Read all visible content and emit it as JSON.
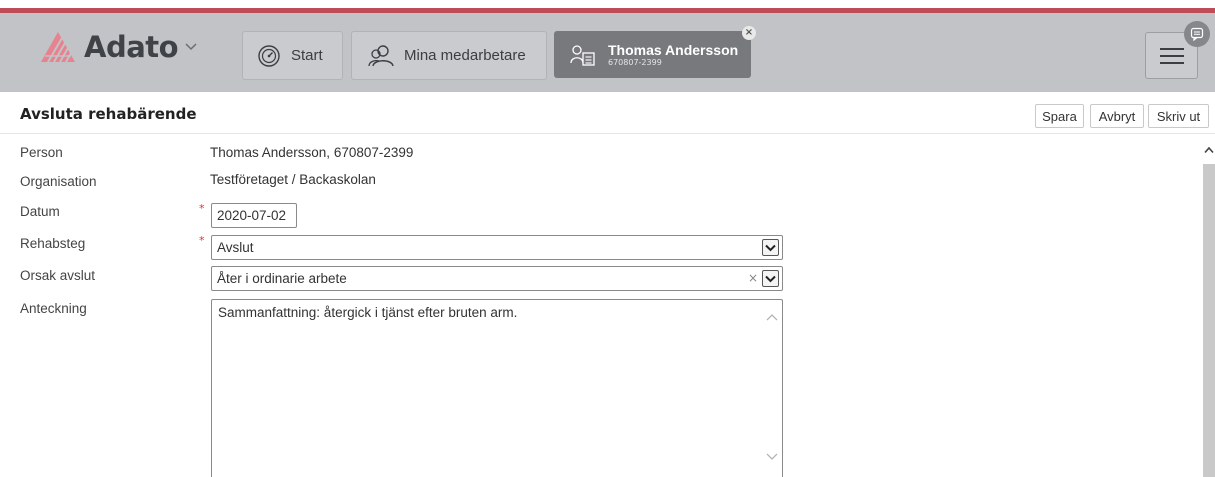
{
  "header": {
    "brand": "Adato",
    "nav": {
      "start": "Start",
      "mina_medarbetare": "Mina medarbetare"
    },
    "active_person": {
      "name": "Thomas Andersson",
      "id": "670807-2399"
    },
    "close_glyph": "×",
    "icons": {
      "logo": "adato-triangle-logo",
      "brand_menu": "chevron-down-icon",
      "start": "dashboard-gauge-icon",
      "team": "users-icon",
      "person_card": "person-card-icon",
      "menu": "hamburger-menu-icon",
      "chat": "chat-bubble-icon"
    },
    "colors": {
      "accent": "#bf4d58",
      "header_bg": "#c1c3c6",
      "active_tab_bg": "#77797d"
    }
  },
  "page": {
    "title": "Avsluta rehabärende",
    "actions": {
      "save": "Spara",
      "cancel": "Avbryt",
      "print": "Skriv ut"
    }
  },
  "form": {
    "person": {
      "label": "Person",
      "value": "Thomas Andersson, 670807-2399"
    },
    "organisation": {
      "label": "Organisation",
      "value": "Testföretaget / Backaskolan"
    },
    "datum": {
      "label": "Datum",
      "value": "2020-07-02",
      "required": true
    },
    "rehabsteg": {
      "label": "Rehabsteg",
      "value": "Avslut",
      "required": true
    },
    "orsak_avslut": {
      "label": "Orsak avslut",
      "value": "Åter i ordinarie arbete"
    },
    "anteckning": {
      "label": "Anteckning",
      "value": "Sammanfattning: återgick i tjänst efter bruten arm."
    }
  },
  "required_marker": "*",
  "clear_glyph": "×"
}
